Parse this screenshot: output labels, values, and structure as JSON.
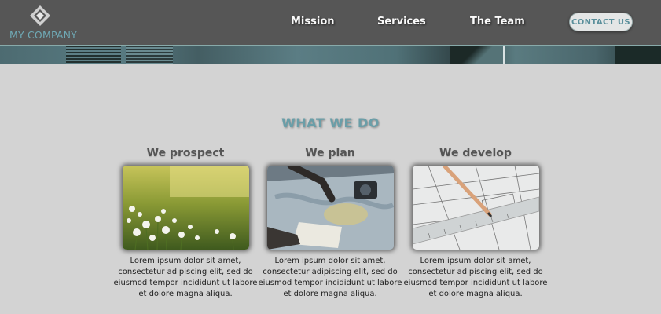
{
  "header": {
    "logo_text": "MY COMPANY",
    "nav": {
      "mission": "Mission",
      "services": "Services",
      "team": "The Team"
    },
    "contact_label": "CONTACT US"
  },
  "main": {
    "section_title": "WHAT WE DO",
    "cards": [
      {
        "heading": "We prospect",
        "text": "Lorem ipsum dolor sit amet, consectetur adipiscing elit, sed do eiusmod tempor incididunt ut labore et dolore magna aliqua."
      },
      {
        "heading": "We plan",
        "text": "Lorem ipsum dolor sit amet, consectetur adipiscing elit, sed do eiusmod tempor incididunt ut labore et dolore magna aliqua."
      },
      {
        "heading": "We develop",
        "text": "Lorem ipsum dolor sit amet, consectetur adipiscing elit, sed do eiusmod tempor incididunt ut labore et dolore magna aliqua."
      }
    ]
  },
  "colors": {
    "header_bg": "#565656",
    "accent": "#6fa9b5",
    "page_bg": "#d3d3d3"
  },
  "icons": {
    "logo": "diamond-logo-icon"
  }
}
